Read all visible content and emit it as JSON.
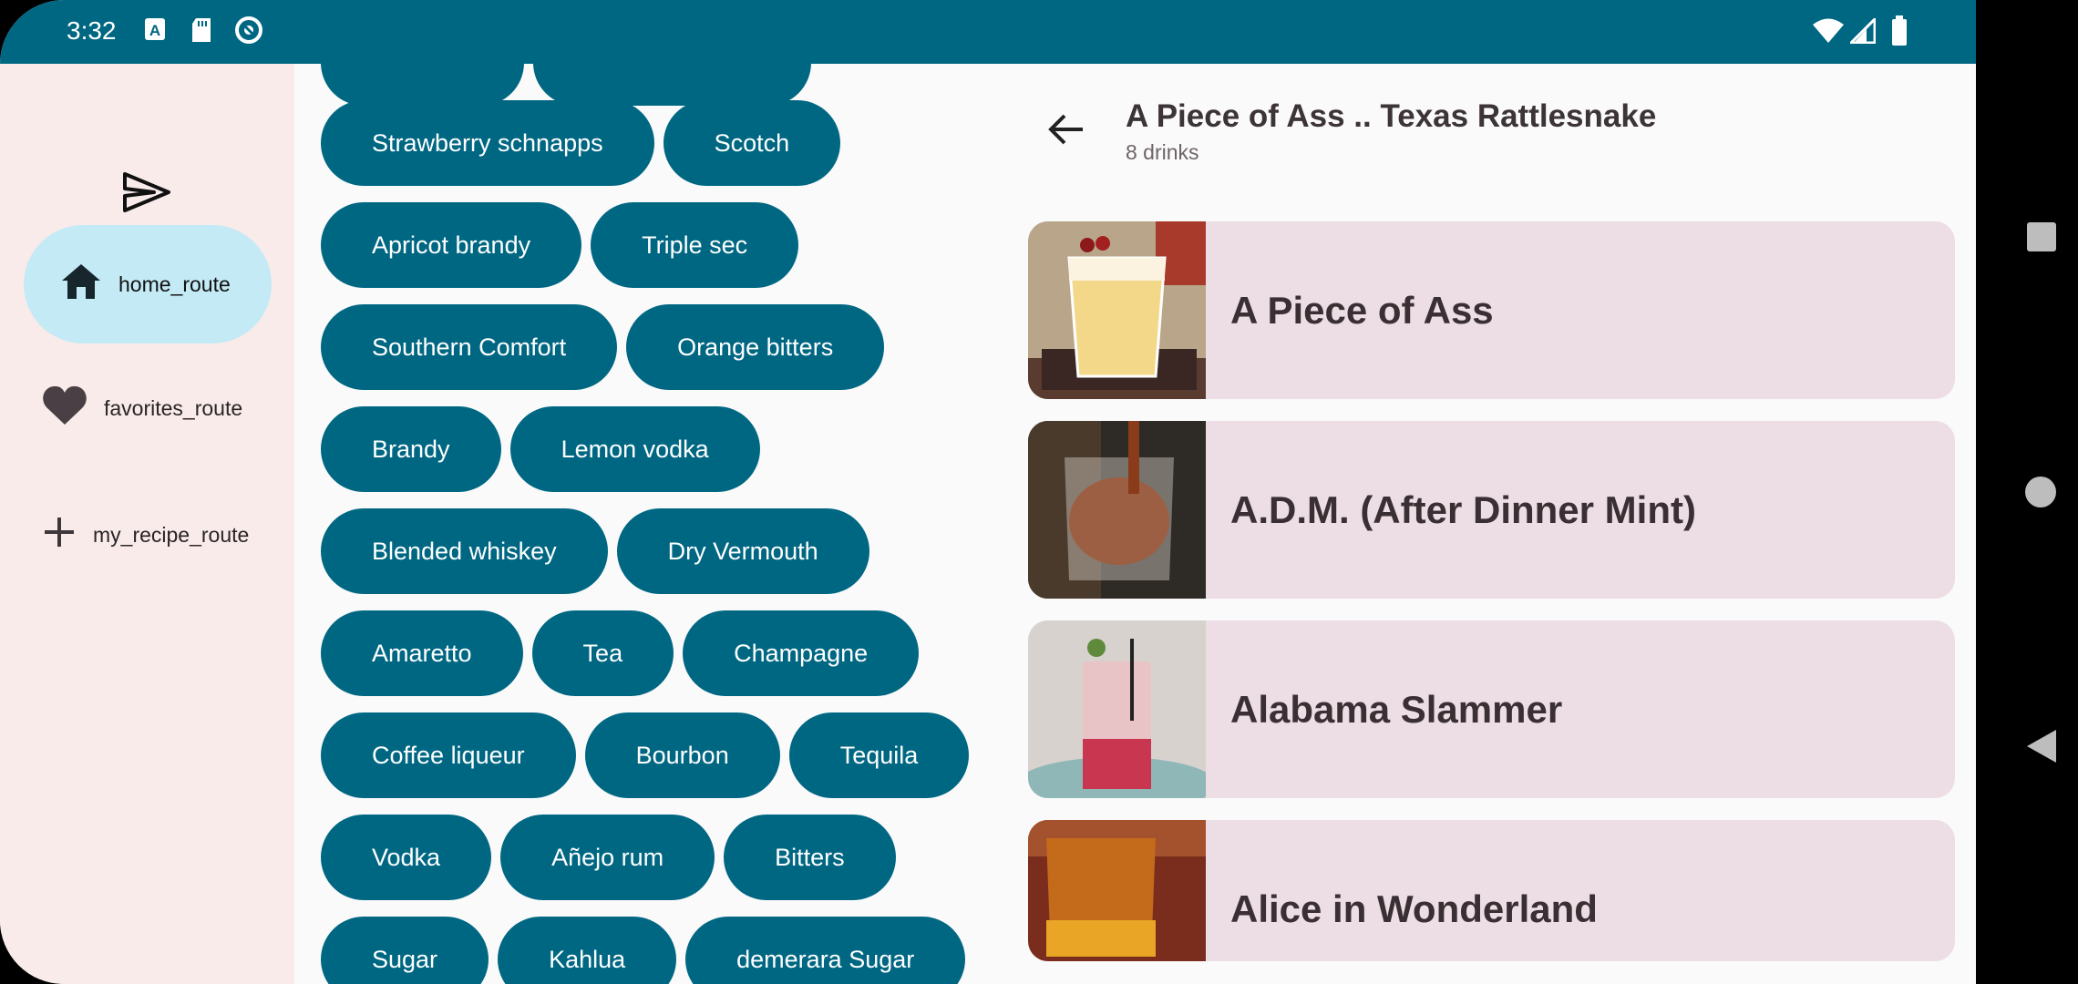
{
  "status_bar": {
    "time": "3:32",
    "left_icons": [
      "font-a-icon",
      "sd-card-icon",
      "sync-icon"
    ],
    "right_icons": [
      "wifi-icon",
      "signal-icon",
      "battery-icon"
    ]
  },
  "nav_rail": {
    "fab_icon": "send-icon",
    "items": [
      {
        "label": "home_route",
        "icon": "home-icon",
        "selected": true
      },
      {
        "label": "favorites_route",
        "icon": "heart-icon",
        "selected": false
      },
      {
        "label": "my_recipe_route",
        "icon": "plus-icon",
        "selected": false
      }
    ]
  },
  "ingredients": {
    "rows": [
      [
        "Strawberry schnapps",
        "Scotch"
      ],
      [
        "Apricot brandy",
        "Triple sec"
      ],
      [
        "Southern Comfort",
        "Orange bitters"
      ],
      [
        "Brandy",
        "Lemon vodka"
      ],
      [
        "Blended whiskey",
        "Dry Vermouth"
      ],
      [
        "Amaretto",
        "Tea",
        "Champagne"
      ],
      [
        "Coffee liqueur",
        "Bourbon",
        "Tequila"
      ],
      [
        "Vodka",
        "Añejo rum",
        "Bitters"
      ],
      [
        "Sugar",
        "Kahlua",
        "demerara Sugar"
      ]
    ]
  },
  "detail": {
    "title": "A Piece of Ass .. Texas Rattlesnake",
    "subtitle": "8 drinks",
    "drinks": [
      {
        "name": "A Piece of Ass"
      },
      {
        "name": "A.D.M. (After Dinner Mint)"
      },
      {
        "name": "Alabama Slammer"
      },
      {
        "name": "Alice in Wonderland"
      }
    ]
  },
  "colors": {
    "primary": "#006783",
    "rail_bg": "#f9ebea",
    "selected_pill": "#c3eaf5",
    "card_bg": "#eddde5"
  }
}
